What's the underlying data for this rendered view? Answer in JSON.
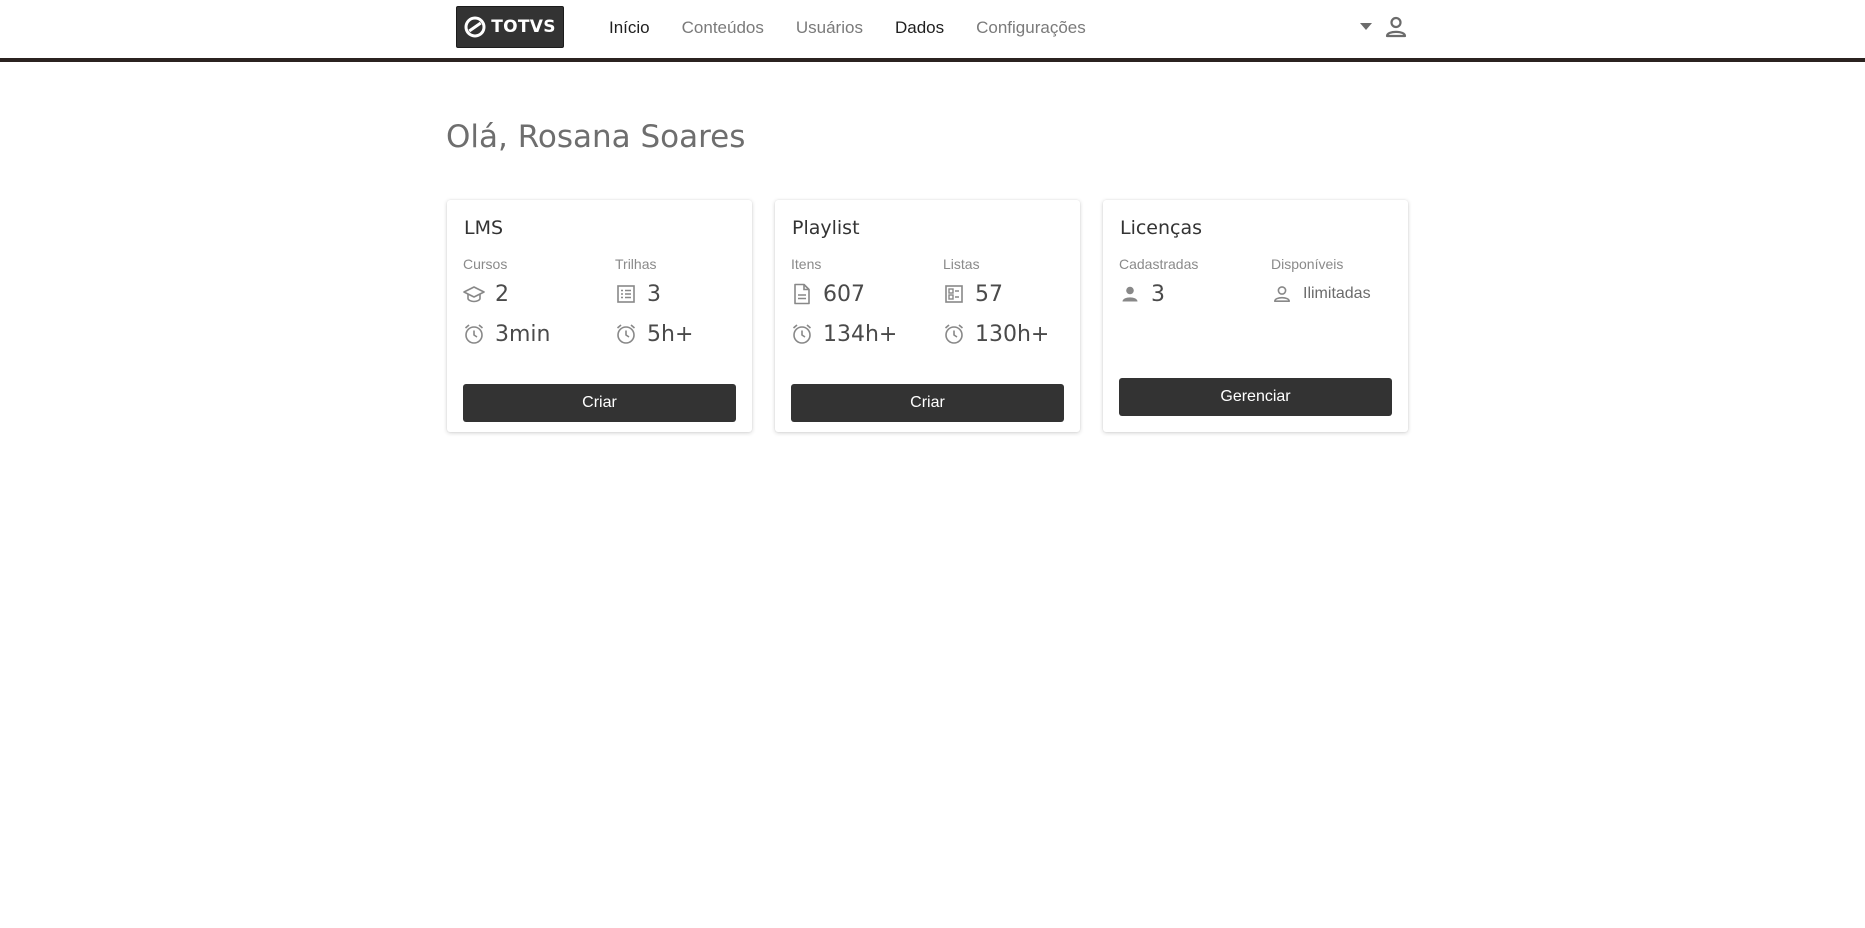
{
  "header": {
    "logo_text": "TOTVS",
    "nav": [
      {
        "label": "Início"
      },
      {
        "label": "Conteúdos"
      },
      {
        "label": "Usuários"
      },
      {
        "label": "Dados"
      },
      {
        "label": "Configurações"
      }
    ],
    "icons": {
      "dropdown": "chevron-down-icon",
      "user": "user-icon"
    }
  },
  "greeting": "Olá, Rosana Soares",
  "cards": {
    "lms": {
      "title": "LMS",
      "col1_label": "Cursos",
      "col2_label": "Trilhas",
      "cursos_count": "2",
      "trilhas_count": "3",
      "cursos_time": "3min",
      "trilhas_time": "5h+",
      "button": "Criar"
    },
    "playlist": {
      "title": "Playlist",
      "col1_label": "Itens",
      "col2_label": "Listas",
      "itens_count": "607",
      "listas_count": "57",
      "itens_time": "134h+",
      "listas_time": "130h+",
      "button": "Criar"
    },
    "licencas": {
      "title": "Licenças",
      "col1_label": "Cadastradas",
      "col2_label": "Disponíveis",
      "cadastradas": "3",
      "disponiveis": "Ilimitadas",
      "button": "Gerenciar"
    }
  },
  "colors": {
    "primary_button": "#333333",
    "header_border": "#2b2320",
    "text_muted": "#8a8a8a"
  }
}
